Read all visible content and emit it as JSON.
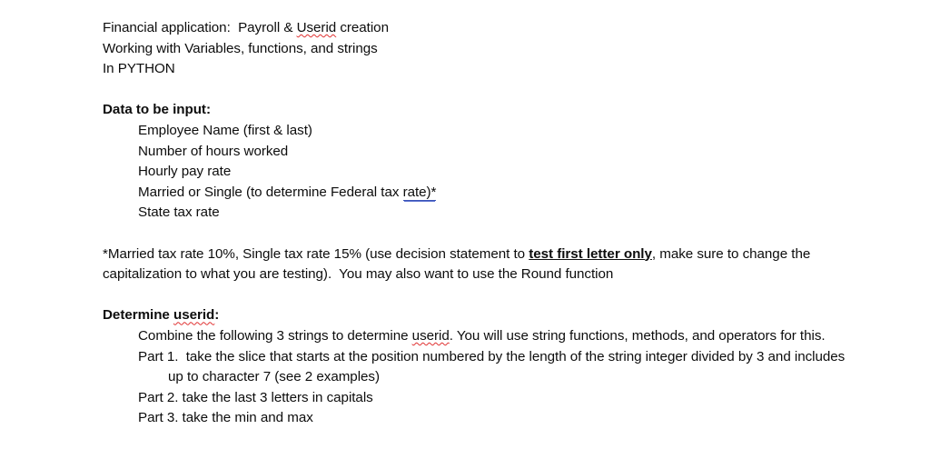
{
  "document": {
    "title_block": {
      "lines": [
        {
          "pre": "Financial application:  Payroll & ",
          "spell": "Userid",
          "post": " creation"
        },
        {
          "text": "Working with Variables, functions, and strings"
        },
        {
          "text": "In PYTHON"
        }
      ],
      "line1_pre": "Financial application:  Payroll & ",
      "line1_spell": "Userid",
      "line1_post": " creation",
      "line2": "Working with Variables, functions, and strings",
      "line3": "In PYTHON"
    },
    "data_section": {
      "heading": "Data to be input:",
      "items": [
        "Employee Name (first & last)",
        "Number of hours worked",
        "Hourly pay rate",
        "State tax rate"
      ],
      "item_employee_name": "Employee Name (first & last)",
      "item_hours": "Number of hours worked",
      "item_pay_rate": "Hourly pay rate",
      "item_married_pre": "Married or Single (to determine Federal tax ",
      "item_married_grammar": "rate)*",
      "item_state_tax": "State tax rate"
    },
    "tax_note": {
      "pre": "*Married tax rate 10%, Single tax rate 15% (use decision statement to ",
      "bold_underline": "test first letter only",
      "post": ", make sure to change the capitalization to what you are testing).  You may also want to use the Round function"
    },
    "userid_section": {
      "heading_pre": "Determine ",
      "heading_spell": "userid",
      "heading_post": ":",
      "intro_pre": "Combine the following 3 strings to determine ",
      "intro_spell": "userid",
      "intro_post": ". You will use string functions, methods, and operators for this.",
      "parts": [
        "Part 1.  take the slice that starts at the position numbered by the length of the string integer divided by 3 and includes up to character 7 (see 2 examples)",
        "Part 2. take the last 3 letters in capitals",
        "Part 3. take the min and max"
      ],
      "part1": "Part 1.  take the slice that starts at the position numbered by the length of the string integer divided by 3 and includes up to character 7 (see 2 examples)",
      "part2": "Part 2. take the last 3 letters in capitals",
      "part3": "Part 3. take the min and max"
    },
    "colors": {
      "page_background": "#ffffff",
      "text": "#0d0d0d",
      "spellcheck_underline": "#e03131",
      "grammarcheck_underline": "#3a53b8"
    }
  }
}
